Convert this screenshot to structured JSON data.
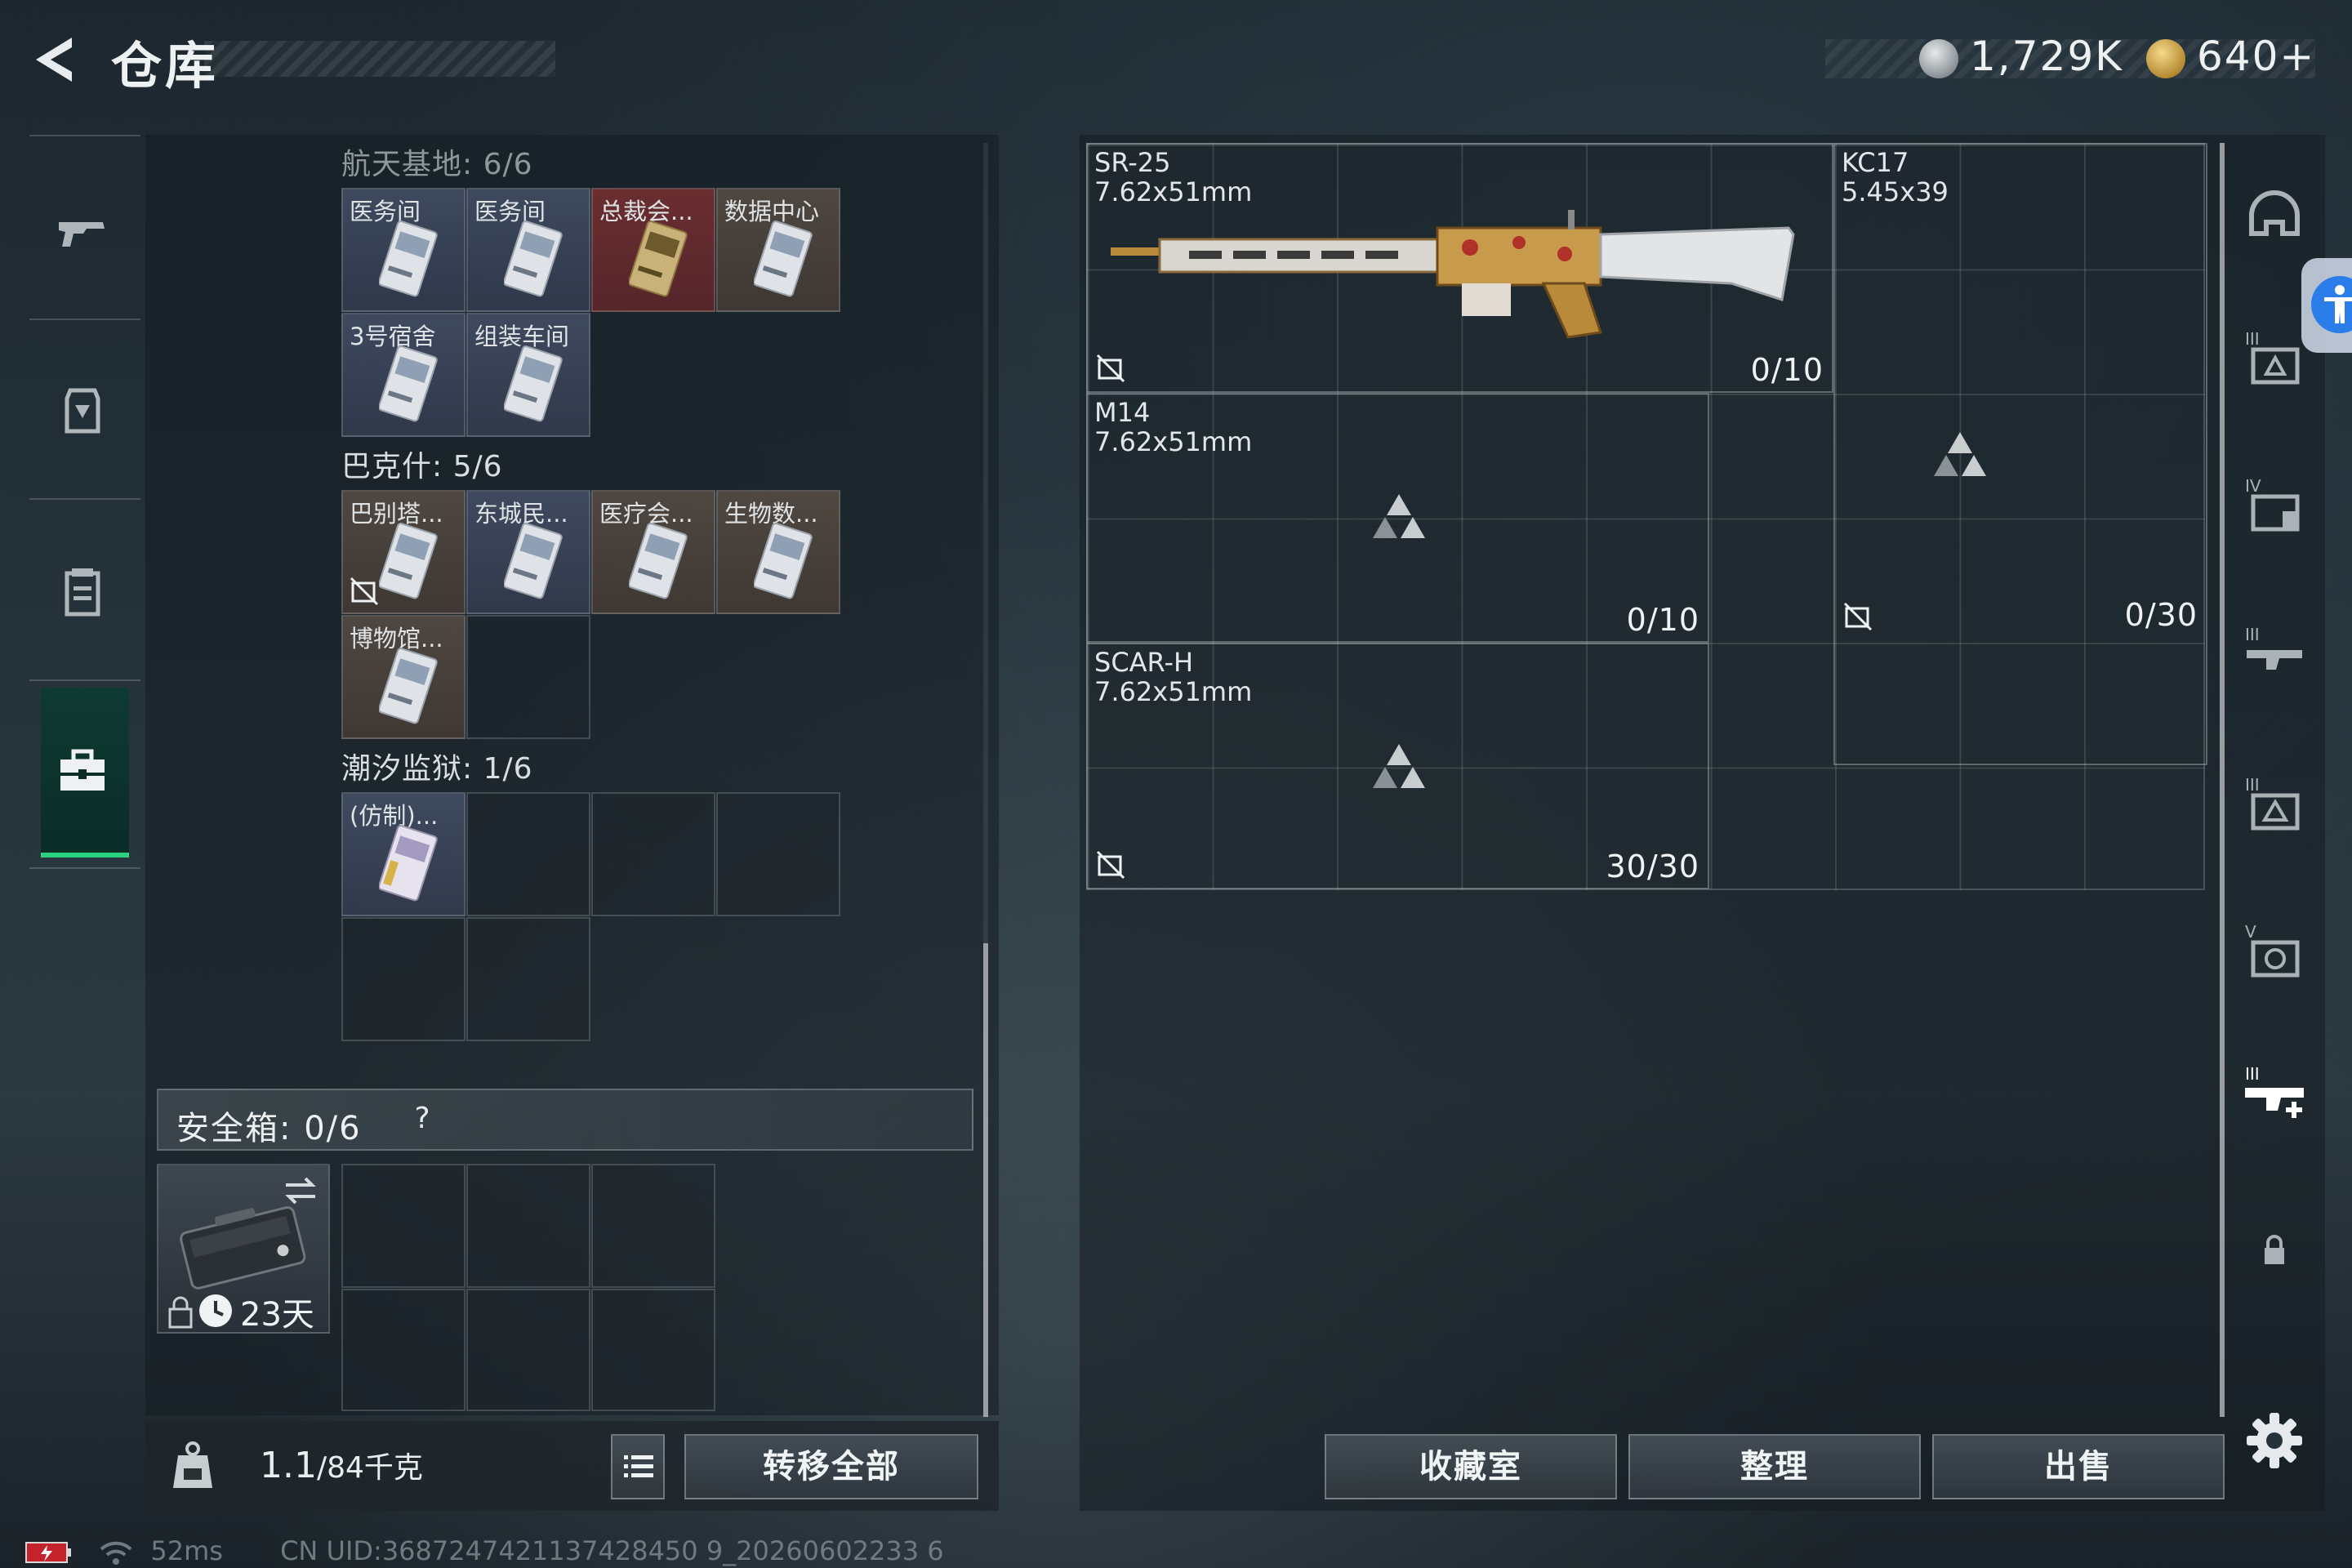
{
  "header": {
    "title": "仓库",
    "currency_primary": "1,729K",
    "currency_secondary": "640+"
  },
  "sidebar": {
    "items": [
      {
        "name": "weapons"
      },
      {
        "name": "equipment"
      },
      {
        "name": "consumables"
      },
      {
        "name": "keys",
        "active": true
      }
    ]
  },
  "key_groups": [
    {
      "title": "航天基地: 6/6",
      "cards": [
        "医务间",
        "医务间",
        "总裁会...",
        "数据中心",
        "3号宿舍",
        "组装车间"
      ]
    },
    {
      "title": "巴克什: 5/6",
      "cards": [
        "巴别塔...",
        "东城民...",
        "医疗会...",
        "生物数...",
        "博物馆..."
      ]
    },
    {
      "title": "潮汐监狱: 1/6",
      "cards": [
        "(仿制)..."
      ]
    }
  ],
  "safebox": {
    "label": "安全箱: 0/6",
    "help": "?",
    "days": "23天"
  },
  "bottom": {
    "weight_value": "1.1",
    "weight_max": "/84千克",
    "transfer_all": "转移全部",
    "collection": "收藏室",
    "sort": "整理",
    "sell": "出售"
  },
  "slots": [
    {
      "name": "SR-25",
      "caliber": "7.62x51mm",
      "count": "0/10"
    },
    {
      "name": "KC17",
      "caliber": "5.45x39",
      "count": "0/30"
    },
    {
      "name": "M14",
      "caliber": "7.62x51mm",
      "count": "0/10"
    },
    {
      "name": "SCAR-H",
      "caliber": "7.62x51mm",
      "count": "30/30"
    }
  ],
  "status": {
    "ping": "52ms",
    "uid": "CN UID:3687247421137428450 9_20260602233 6"
  },
  "colors": {
    "accent_green": "#29d37f",
    "accessibility_blue": "#2b7de9"
  }
}
